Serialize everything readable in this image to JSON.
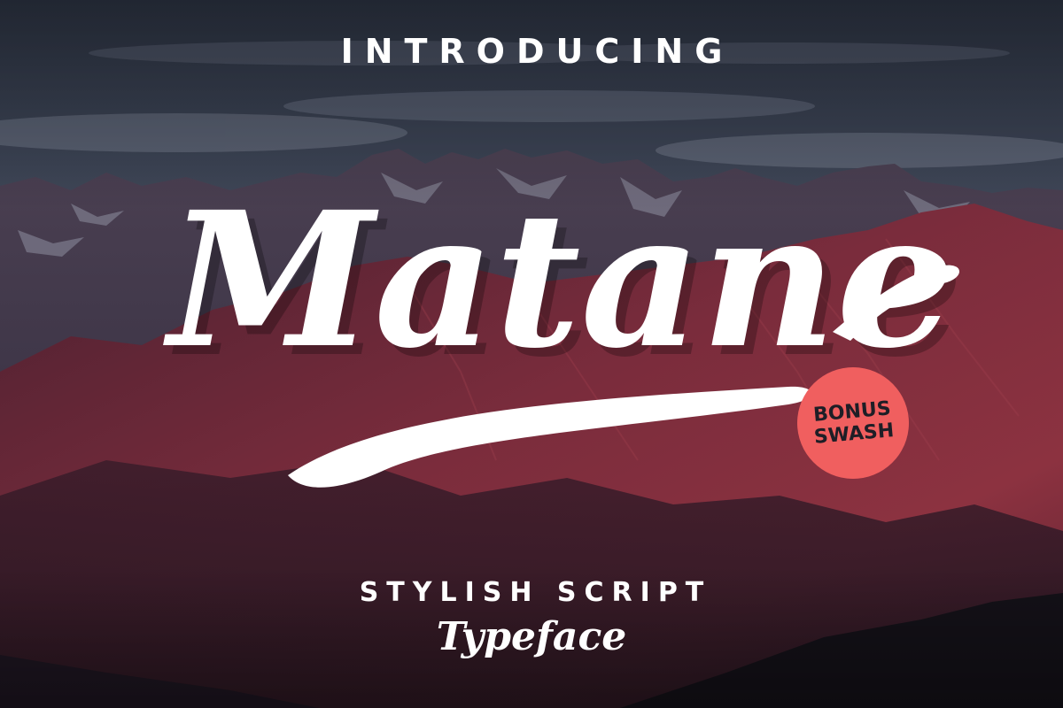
{
  "poster": {
    "intro_text": "INTRODUCING",
    "title": "Matane",
    "badge": {
      "line1": "BONUS",
      "line2": "SWASH",
      "color": "#f05f5f"
    },
    "tagline": "STYLISH SCRIPT",
    "subtitle": "Typeface"
  },
  "colors": {
    "text": "#ffffff",
    "sky": "#3a4253",
    "mountain_snow": "#5a5c6c",
    "mountain_red": "#7a2a3a",
    "foreground_dark": "#15131a"
  }
}
